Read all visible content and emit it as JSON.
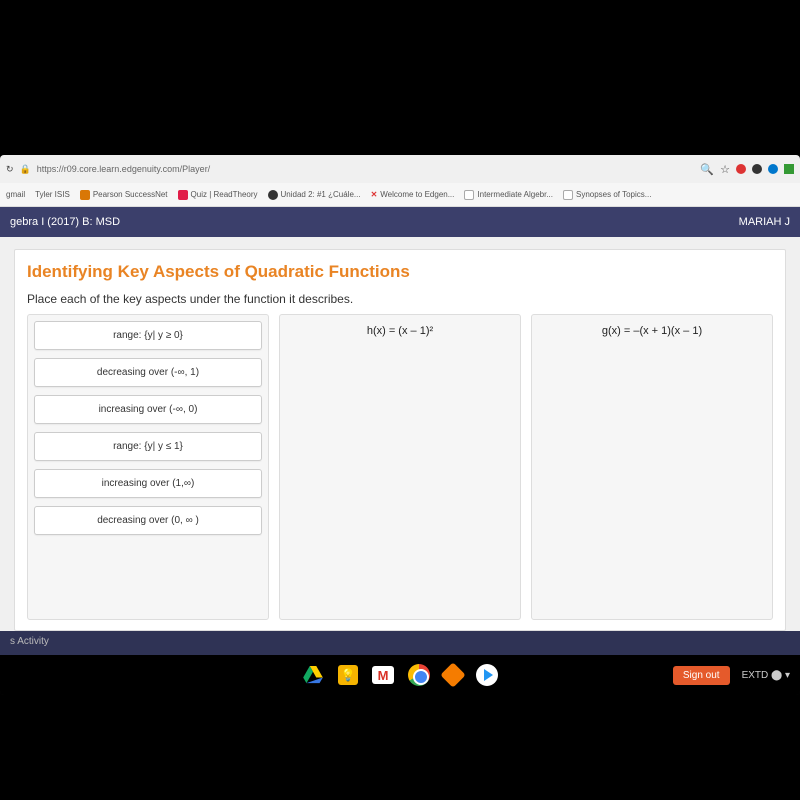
{
  "browser": {
    "url": "https://r09.core.learn.edgenuity.com/Player/",
    "reload_icon": "↻",
    "lock_icon": "🔒",
    "zoom_icon": "🔍",
    "star_icon": "☆"
  },
  "bookmarks": {
    "items": [
      {
        "label": "gmail"
      },
      {
        "label": "Tyler ISIS"
      },
      {
        "label": "Pearson SuccessNet"
      },
      {
        "label": "Quiz | ReadTheory"
      },
      {
        "label": "Unidad 2: #1 ¿Cuále..."
      },
      {
        "label": "Welcome to Edgen..."
      },
      {
        "label": "Intermediate Algebr..."
      },
      {
        "label": "Synopses of Topics..."
      }
    ]
  },
  "course": {
    "title": "gebra I (2017) B: MSD",
    "user": "MARIAH J"
  },
  "lesson": {
    "heading": "Identifying Key Aspects of Quadratic Functions",
    "instruction": "Place each of the key aspects under the function it describes.",
    "source_col": {
      "header": "range: {y| y ≥ 0}",
      "tiles": [
        "decreasing over (-∞, 1)",
        "increasing over (-∞, 0)",
        "range: {y| y ≤ 1}",
        "increasing over (1,∞)",
        "decreasing over (0, ∞ )"
      ]
    },
    "target_cols": [
      {
        "header": "h(x) = (x – 1)²"
      },
      {
        "header": "g(x) = –(x + 1)(x – 1)"
      }
    ]
  },
  "activity": {
    "label": "s Activity"
  },
  "taskbar": {
    "signout": "Sign out",
    "systray": "EXTD  ⬤ ▾"
  }
}
